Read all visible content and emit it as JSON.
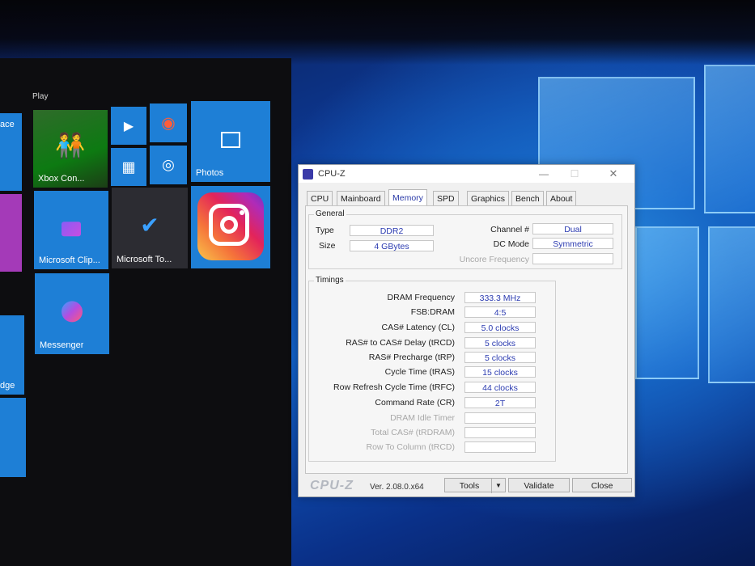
{
  "start_menu": {
    "group_label": "Play",
    "tiles": [
      {
        "label": "ace"
      },
      {
        "label": ""
      },
      {
        "label": "Xbox Con..."
      },
      {
        "label": ""
      },
      {
        "label": ""
      },
      {
        "label": ""
      },
      {
        "label": ""
      },
      {
        "label": "Photos"
      },
      {
        "label": "Microsoft Clip..."
      },
      {
        "label": "Microsoft To..."
      },
      {
        "label": ""
      },
      {
        "label": "Messenger"
      },
      {
        "label": "dge"
      },
      {
        "label": ""
      },
      {
        "label": ""
      }
    ]
  },
  "cpuz": {
    "title": "CPU-Z",
    "tabs": [
      {
        "label": "CPU"
      },
      {
        "label": "Mainboard"
      },
      {
        "label": "Memory"
      },
      {
        "label": "SPD"
      },
      {
        "label": "Graphics"
      },
      {
        "label": "Bench"
      },
      {
        "label": "About"
      }
    ],
    "general": {
      "legend": "General",
      "type_label": "Type",
      "type_value": "DDR2",
      "size_label": "Size",
      "size_value": "4 GBytes",
      "channel_label": "Channel #",
      "channel_value": "Dual",
      "dcmode_label": "DC Mode",
      "dcmode_value": "Symmetric",
      "uncore_label": "Uncore Frequency",
      "uncore_value": ""
    },
    "timings": {
      "legend": "Timings",
      "rows": [
        {
          "label": "DRAM Frequency",
          "value": "333.3 MHz"
        },
        {
          "label": "FSB:DRAM",
          "value": "4:5"
        },
        {
          "label": "CAS# Latency (CL)",
          "value": "5.0 clocks"
        },
        {
          "label": "RAS# to CAS# Delay (tRCD)",
          "value": "5 clocks"
        },
        {
          "label": "RAS# Precharge (tRP)",
          "value": "5 clocks"
        },
        {
          "label": "Cycle Time (tRAS)",
          "value": "15 clocks"
        },
        {
          "label": "Row Refresh Cycle Time (tRFC)",
          "value": "44 clocks"
        },
        {
          "label": "Command Rate (CR)",
          "value": "2T"
        },
        {
          "label": "DRAM Idle Timer",
          "value": ""
        },
        {
          "label": "Total CAS# (tRDRAM)",
          "value": ""
        },
        {
          "label": "Row To Column (tRCD)",
          "value": ""
        }
      ]
    },
    "footer": {
      "brand": "CPU-Z",
      "version": "Ver. 2.08.0.x64",
      "tools_label": "Tools",
      "validate_label": "Validate",
      "close_label": "Close"
    }
  }
}
